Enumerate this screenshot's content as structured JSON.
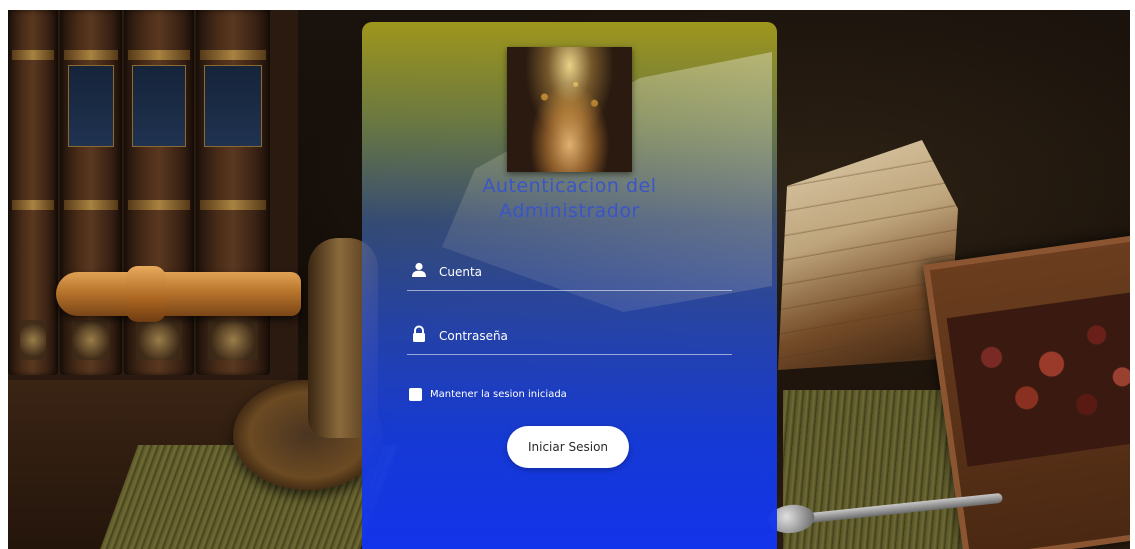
{
  "login": {
    "title_line1": "Autenticacion del",
    "title_line2": "Administrador",
    "account_placeholder": "Cuenta",
    "password_placeholder": "Contraseña",
    "remember_label": "Mantener la sesion iniciada",
    "submit_label": "Iniciar Sesion"
  },
  "icons": {
    "account": "user-icon",
    "password": "lock-icon"
  },
  "colors": {
    "card_top": "#a8a01e",
    "card_bottom": "#1234ee",
    "title": "#3a55c8",
    "button_bg": "#ffffff"
  }
}
